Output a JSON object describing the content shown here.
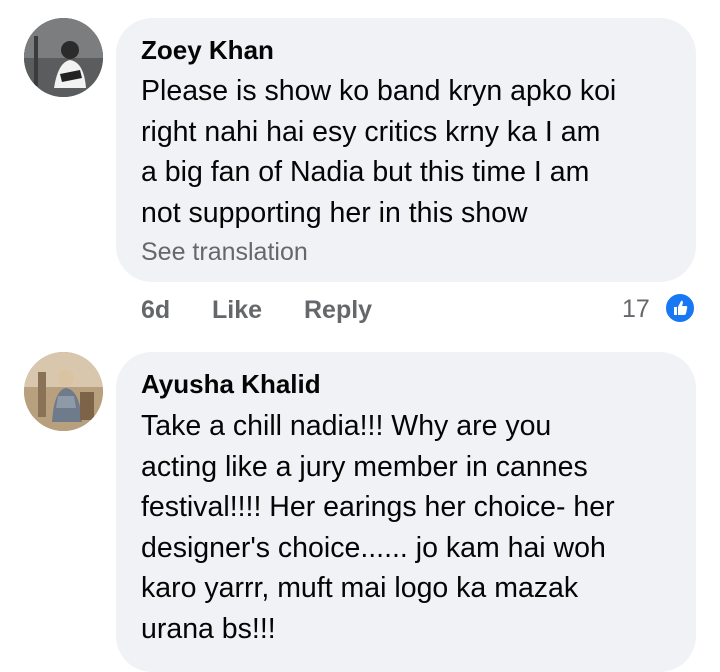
{
  "comments": [
    {
      "author": "Zoey Khan",
      "lines": [
        "Please is show ko band kryn apko koi",
        "right nahi hai esy critics krny ka I am",
        "a big fan of Nadia but this time I am",
        "not supporting her in this show"
      ],
      "see_translation": "See translation",
      "time": "6d",
      "like_label": "Like",
      "reply_label": "Reply",
      "reaction_count": "17",
      "reaction_icon": "thumbs-up-icon"
    },
    {
      "author": "Ayusha Khalid",
      "lines": [
        "Take a chill nadia!!! Why are you",
        "acting like a jury member in cannes",
        "festival!!!! Her earings her choice- her",
        "designer's choice...... jo kam hai woh",
        "karo yarrr, muft mai logo ka mazak",
        "urana bs!!!"
      ]
    }
  ],
  "colors": {
    "bubble_bg": "#f0f2f5",
    "secondary_text": "#65676b",
    "like_blue": "#1877f2"
  }
}
